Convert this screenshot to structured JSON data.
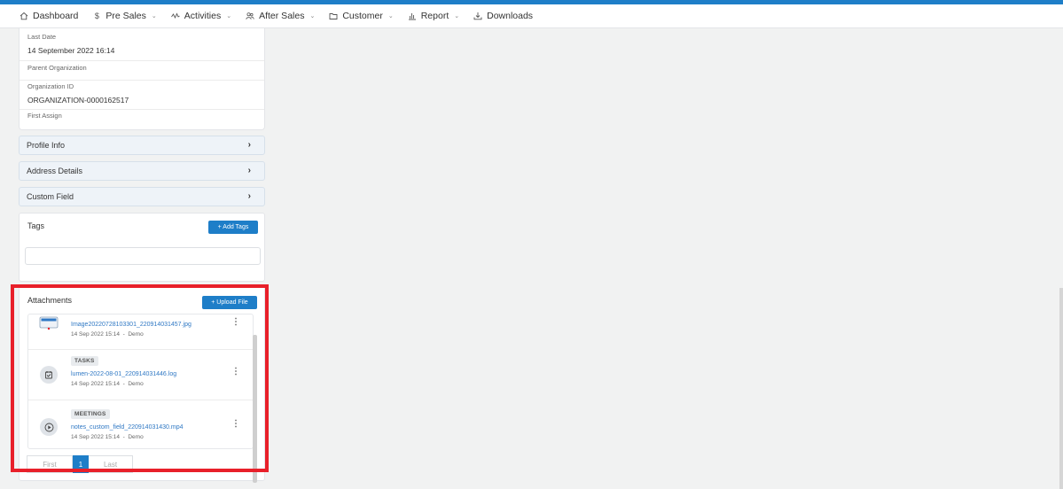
{
  "nav": {
    "items": [
      {
        "label": "Dashboard",
        "icon": "home-icon",
        "dropdown": false
      },
      {
        "label": "Pre Sales",
        "icon": "dollar-icon",
        "dropdown": true
      },
      {
        "label": "Activities",
        "icon": "activity-icon",
        "dropdown": true
      },
      {
        "label": "After Sales",
        "icon": "users-icon",
        "dropdown": true
      },
      {
        "label": "Customer",
        "icon": "folder-icon",
        "dropdown": true
      },
      {
        "label": "Report",
        "icon": "bar-chart-icon",
        "dropdown": true
      },
      {
        "label": "Downloads",
        "icon": "download-icon",
        "dropdown": false
      }
    ]
  },
  "info": {
    "last_date_label": "Last Date",
    "last_date_value": "14 September 2022 16:14",
    "parent_org_label": "Parent Organization",
    "org_id_label": "Organization ID",
    "org_id_value": "ORGANIZATION-0000162517",
    "first_assign_label": "First Assign"
  },
  "accordions": [
    "Profile Info",
    "Address Details",
    "Custom Field"
  ],
  "tags": {
    "title": "Tags",
    "add_label": "+ Add Tags"
  },
  "attachments": {
    "title": "Attachments",
    "upload_label": "+ Upload File",
    "items": [
      {
        "badge": "",
        "name": "Image20220728103301_220914031457.jpg",
        "date": "14 Sep 2022 15:14",
        "user": "Demo",
        "icon": "image-file-icon"
      },
      {
        "badge": "TASKS",
        "name": "lumen-2022-08-01_220914031446.log",
        "date": "14 Sep 2022 15:14",
        "user": "Demo",
        "icon": "calendar-task-icon"
      },
      {
        "badge": "MEETINGS",
        "name": "notes_custom_field_220914031430.mp4",
        "date": "14 Sep 2022 15:14",
        "user": "Demo",
        "icon": "play-icon"
      }
    ],
    "pager": {
      "first": "First",
      "current": "1",
      "last": "Last"
    }
  },
  "colors": {
    "accent": "#1e7ec8",
    "highlight": "#e8202a",
    "link": "#2f78c4"
  }
}
